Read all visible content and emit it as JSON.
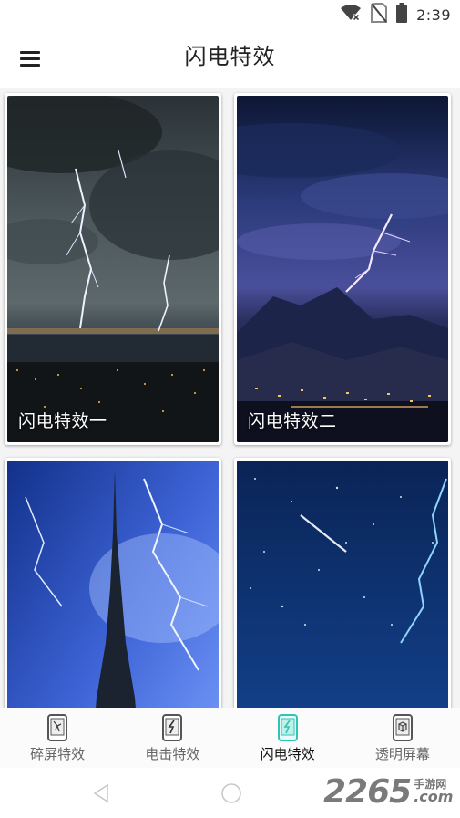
{
  "status_bar": {
    "time": "2:39",
    "icons": [
      "wifi-off-icon",
      "no-sim-icon",
      "battery-icon"
    ]
  },
  "app_bar": {
    "title": "闪电特效",
    "menu_icon": "hamburger-menu-icon"
  },
  "cards": [
    {
      "label": "闪电特效一",
      "image": "storm-city-lightning"
    },
    {
      "label": "闪电特效二",
      "image": "purple-lightning-mountains"
    },
    {
      "label": "",
      "image": "skyscraper-lightning"
    },
    {
      "label": "",
      "image": "starry-sky-lightning"
    }
  ],
  "bottom_nav": {
    "items": [
      {
        "label": "碎屏特效",
        "icon": "cracked-phone-icon",
        "active": false
      },
      {
        "label": "电击特效",
        "icon": "shock-phone-icon",
        "active": false
      },
      {
        "label": "闪电特效",
        "icon": "lightning-phone-icon",
        "active": true
      },
      {
        "label": "透明屏幕",
        "icon": "transparent-phone-icon",
        "active": false
      }
    ],
    "active_color": "#2ec4b6"
  },
  "watermark": {
    "number": "2265",
    "small_text": "手游网",
    "domain": ".com"
  }
}
